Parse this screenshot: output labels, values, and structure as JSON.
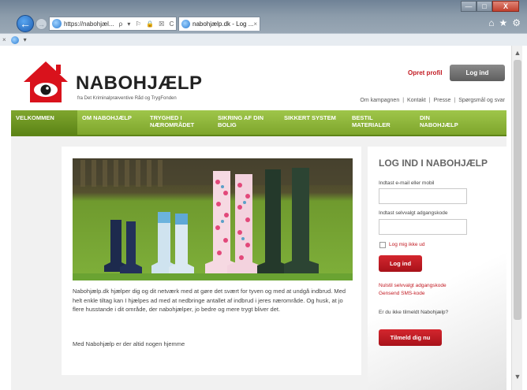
{
  "browser": {
    "url": "https://nabohjæl...",
    "tab_title": "nabohjælp.dk - Log ...",
    "tab_close": "×",
    "address_tools": "ρ ▾ ⚐ 🔒 ☒ C",
    "back_glyph": "←",
    "forward_glyph": "→",
    "home_glyph": "⌂",
    "star_glyph": "★",
    "gear_glyph": "⚙",
    "cmd_close": "×",
    "cmd_dropdown": "▾"
  },
  "window": {
    "minimize": "—",
    "maximize": "□",
    "close": "X"
  },
  "header": {
    "brand": "NABOHJÆLP",
    "subtitle": "fra Det Kriminalpræventive Råd og TrygFonden",
    "opret_profil": "Opret profil",
    "log_ind": "Log ind",
    "top_links": [
      "Om kampagnen",
      "Kontakt",
      "Presse",
      "Spørgsmål og svar"
    ],
    "separator": "|"
  },
  "nav": {
    "items": [
      {
        "l1": "VELKOMMEN",
        "l2": ""
      },
      {
        "l1": "OM NABOHJÆLP",
        "l2": ""
      },
      {
        "l1": "TRYGHED I",
        "l2": "NÆROMRÅDET"
      },
      {
        "l1": "SIKRING AF DIN",
        "l2": "BOLIG"
      },
      {
        "l1": "SIKKERT SYSTEM",
        "l2": ""
      },
      {
        "l1": "BESTIL",
        "l2": "MATERIALER"
      },
      {
        "l1": "DIN",
        "l2": "NABOHJÆLP"
      }
    ]
  },
  "main": {
    "body_text": "Nabohjælp.dk hjælper dig og dit netværk med at gøre det svært for tyven og med at undgå indbrud. Med helt enkle tiltag kan I hjælpes ad med at nedbringe antallet af indbrud i jeres nærområde. Og husk, at jo flere husstande i dit område, der nabohjælper, jo bedre og mere trygt bliver det.",
    "closing_text": "Med Nabohjælp er der altid nogen hjemme"
  },
  "login_panel": {
    "title": "LOG IND I NABOHJÆLP",
    "email_label": "Indtast e-mail eller mobil",
    "email_value": "",
    "password_label": "Indtast selvvalgt adgangskode",
    "password_value": "",
    "remember_label": "Log mig ikke ud",
    "login_button": "Log ind",
    "reset_link": "Nulstil selvvalgt adgangskode",
    "sms_link": "Gensend SMS-kode",
    "question": "Er du ikke tilmeldt Nabohjælp?",
    "signup_button": "Tilmeld dig nu"
  },
  "scrollbar": {
    "up": "▲",
    "down": "▼"
  },
  "colors": {
    "brand_red": "#c21a22",
    "nav_green": "#8db83a",
    "button_gray": "#6f6f6f"
  }
}
